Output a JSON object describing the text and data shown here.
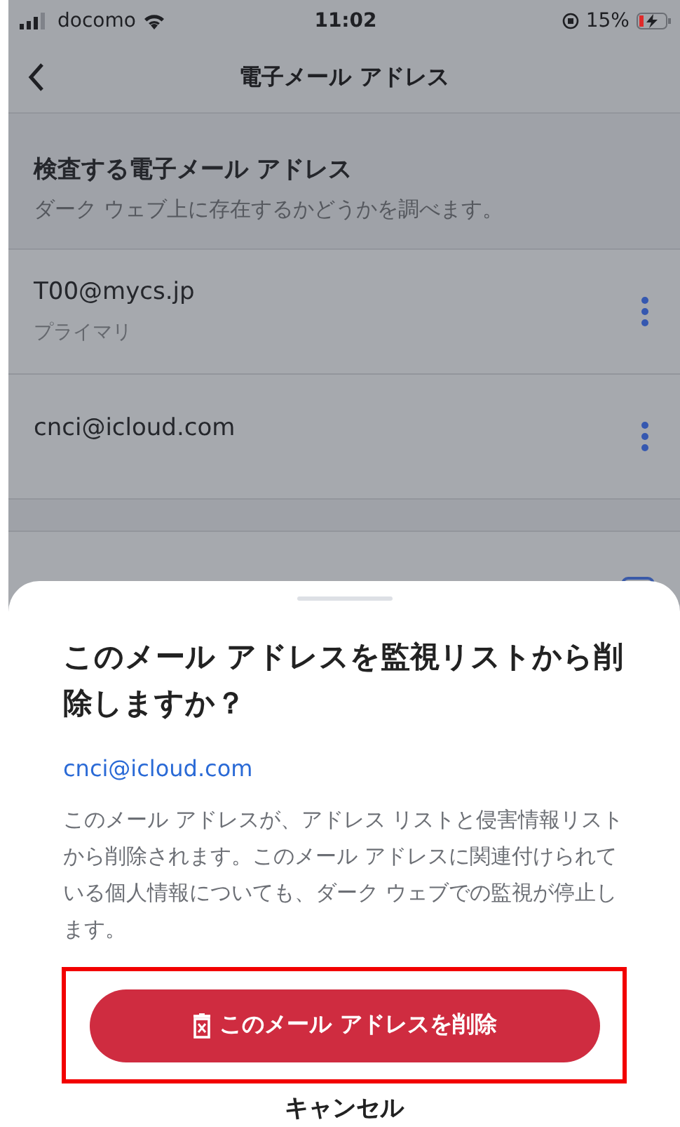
{
  "status_bar": {
    "carrier": "docomo",
    "time": "11:02",
    "battery": "15%"
  },
  "nav": {
    "title": "電子メール アドレス"
  },
  "section": {
    "title": "検査する電子メール アドレス",
    "subtitle": "ダーク ウェブ上に存在するかどうかを調べます。"
  },
  "emails": [
    {
      "address": "T00@mycs.jp",
      "label": "プライマリ"
    },
    {
      "address": "cnci@icloud.com"
    }
  ],
  "sheet": {
    "title": "このメール アドレスを監視リストから削除しますか？",
    "email": "cnci@icloud.com",
    "message": "このメール アドレスが、アドレス リストと侵害情報リストから削除されます。このメール アドレスに関連付けられている個人情報についても、ダーク ウェブでの監視が停止します。",
    "delete_button": {
      "label": "このメール アドレスを削除",
      "highlighted": true
    },
    "cancel_button": {
      "label": "キャンセル"
    }
  }
}
